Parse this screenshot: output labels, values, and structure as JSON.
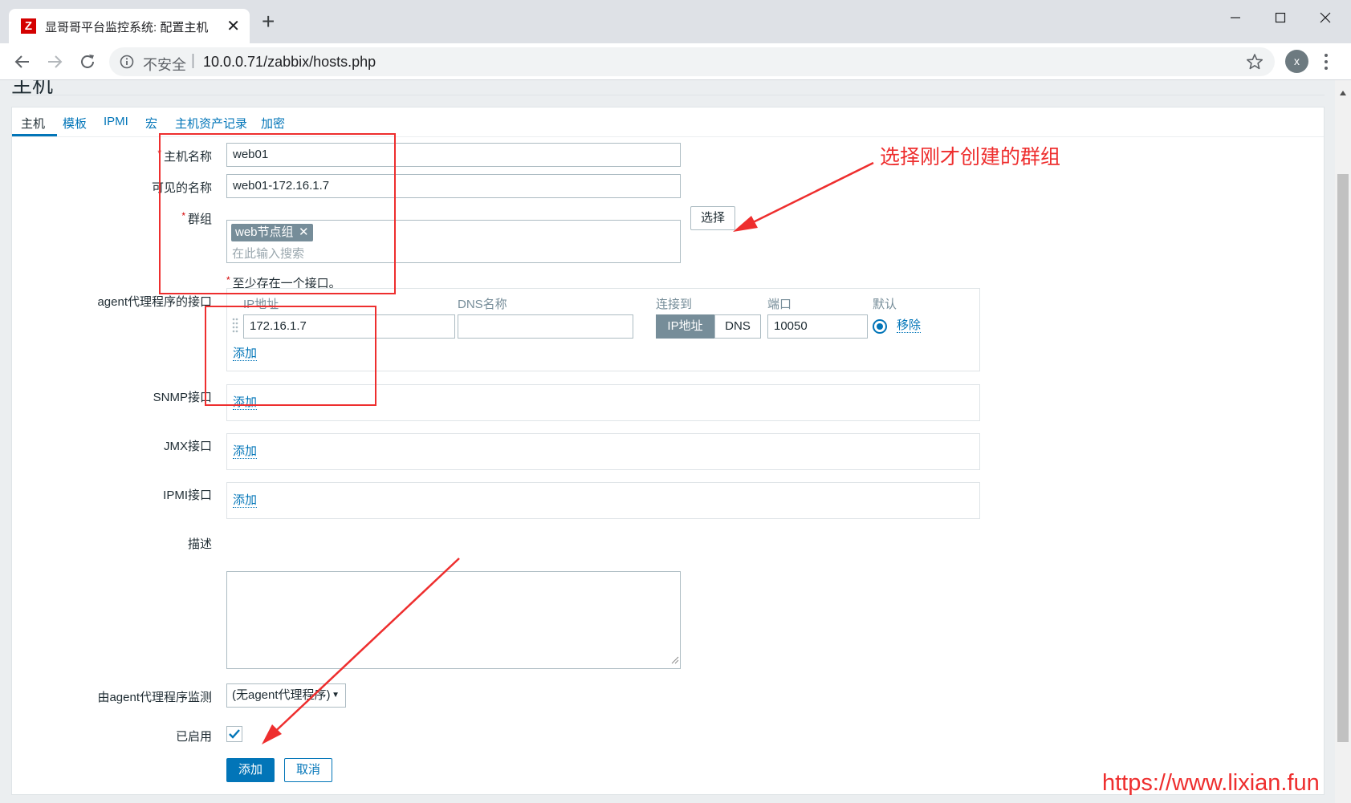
{
  "browser": {
    "tab_title": "显哥哥平台监控系统: 配置主机",
    "favicon_letter": "Z",
    "tab_close": "✕",
    "new_tab": "+",
    "insecure_label": "不安全",
    "url_separator": "|",
    "url": "10.0.0.71/zabbix/hosts.php",
    "profile_initial": "x"
  },
  "page": {
    "heading": "主机",
    "tabs": [
      "主机",
      "模板",
      "IPMI",
      "宏",
      "主机资产记录",
      "加密"
    ]
  },
  "form": {
    "host_name_label": "主机名称",
    "host_name_value": "web01",
    "visible_name_label": "可见的名称",
    "visible_name_value": "web01-172.16.1.7",
    "groups_label": "群组",
    "group_tag": "web节点组",
    "group_tag_remove": "✕",
    "group_search_placeholder": "在此输入搜索",
    "select_button": "选择",
    "required_mark": "*",
    "interface_note": "至少存在一个接口。",
    "agent_iface_label": "agent代理程序的接口",
    "col_ip": "IP地址",
    "col_dns": "DNS名称",
    "col_connect": "连接到",
    "col_port": "端口",
    "col_default": "默认",
    "ip_value": "172.16.1.7",
    "dns_value": "",
    "connect_ip": "IP地址",
    "connect_dns": "DNS",
    "port_value": "10050",
    "remove_link": "移除",
    "add_link": "添加",
    "snmp_label": "SNMP接口",
    "jmx_label": "JMX接口",
    "ipmi_label": "IPMI接口",
    "desc_label": "描述",
    "proxy_label": "由agent代理程序监测",
    "proxy_value": "(无agent代理程序)",
    "enabled_label": "已启用",
    "enabled": true,
    "add_button": "添加",
    "cancel_button": "取消"
  },
  "annotations": {
    "group_hint": "选择刚才创建的群组",
    "watermark": "https://www.lixian.fun",
    "color": "#ee2e2e"
  },
  "colors": {
    "accent": "#0275b8",
    "tag_bg": "#768d99",
    "required": "#d40000"
  }
}
